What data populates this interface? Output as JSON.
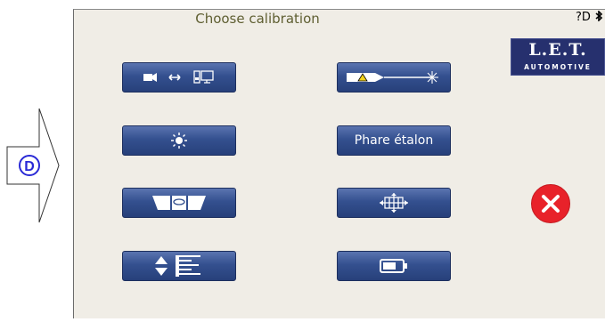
{
  "side_indicator": {
    "letter": "D"
  },
  "header": {
    "title": "Choose calibration",
    "status_text": "?D"
  },
  "logo": {
    "brand": "L.E.T.",
    "sub": "AUTOMOTIVE"
  },
  "buttons": {
    "camera_to_screen": {
      "icon": "camera-to-screen-icon"
    },
    "laser": {
      "icon": "laser-icon"
    },
    "brightness": {
      "icon": "sun-icon"
    },
    "reference_headlight": {
      "label": "Phare étalon"
    },
    "level": {
      "icon": "spirit-level-icon"
    },
    "alignment": {
      "icon": "crosshair-icon"
    },
    "height": {
      "icon": "height-adjust-icon"
    },
    "battery": {
      "icon": "battery-icon"
    }
  },
  "colors": {
    "button": "#34508f",
    "close": "#e8222a",
    "logo": "#26306e",
    "title": "#5f5f32"
  }
}
